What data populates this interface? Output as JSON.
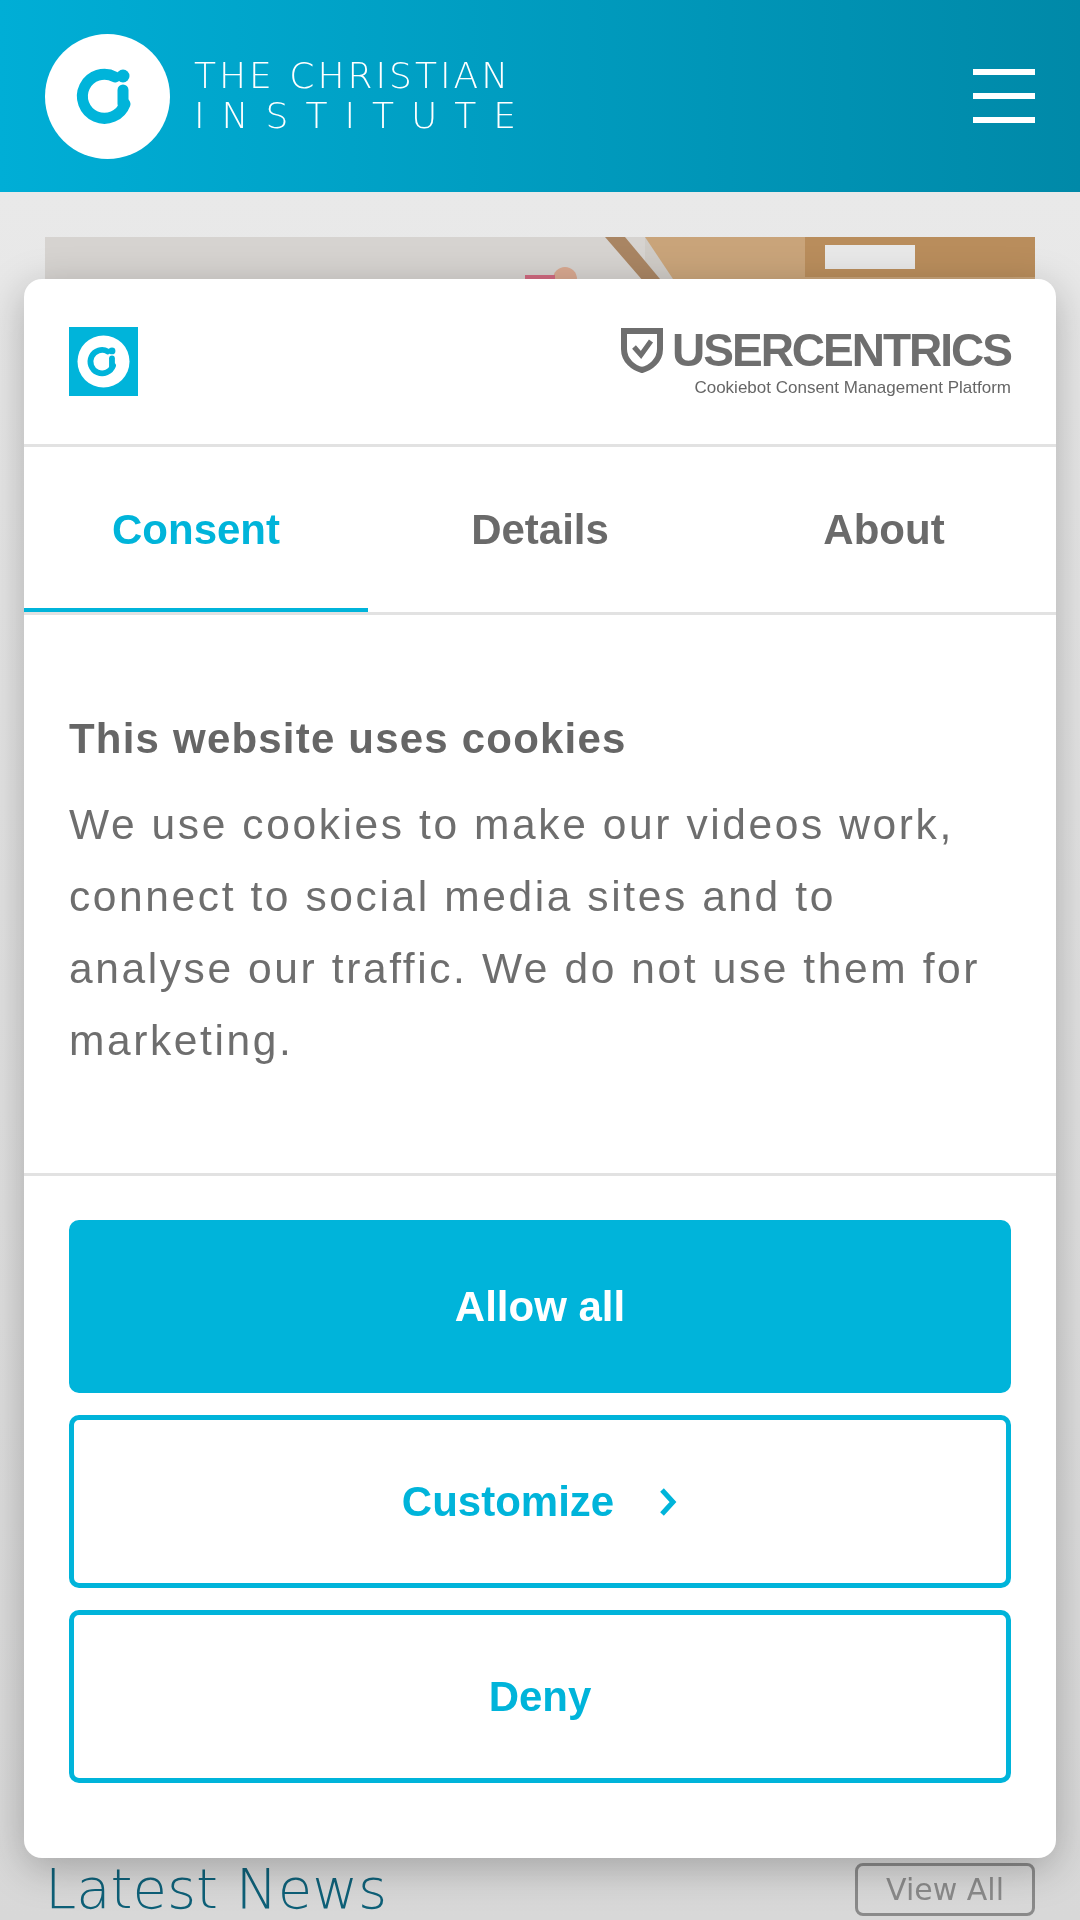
{
  "header": {
    "logo_line_1": "THE CHRISTIAN",
    "logo_line_2": "INSTITUTE"
  },
  "page": {
    "section_title": "Latest News",
    "view_all": "View All"
  },
  "dialog": {
    "brand": "USERCENTRICS",
    "brand_subtitle": "Cookiebot Consent Management Platform",
    "tabs": [
      {
        "label": "Consent",
        "selected": true
      },
      {
        "label": "Details",
        "selected": false
      },
      {
        "label": "About",
        "selected": false
      }
    ],
    "title": "This website uses cookies",
    "body": "We use cookies to make our videos work, connect to social media sites and to analyse our traffic. We do not use them for marketing.",
    "buttons": [
      {
        "label": "Allow all",
        "kind": "primary"
      },
      {
        "label": "Customize",
        "kind": "next"
      },
      {
        "label": "Deny",
        "kind": "secondary"
      }
    ]
  }
}
